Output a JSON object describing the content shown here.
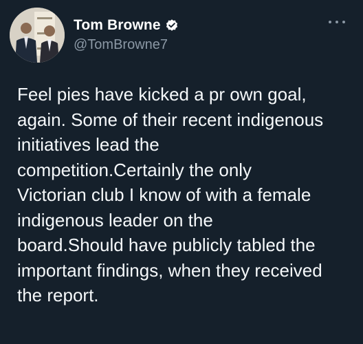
{
  "author": {
    "display_name": "Tom Browne",
    "handle": "@TomBrowne7",
    "verified": true
  },
  "tweet": {
    "text": "Feel pies have kicked a pr own goal,\nagain. Some of their recent indigenous\ninitiatives lead the\ncompetition.Certainly the only\nVictorian club I know of with a female\nindigenous leader on the\nboard.Should have publicly tabled the\nimportant findings, when they received\nthe report."
  },
  "icons": {
    "verified": "verified-badge-icon",
    "more": "more-options-icon"
  },
  "colors": {
    "background": "#15202b",
    "text": "#f5f8fa",
    "secondary": "#8b98a5"
  }
}
